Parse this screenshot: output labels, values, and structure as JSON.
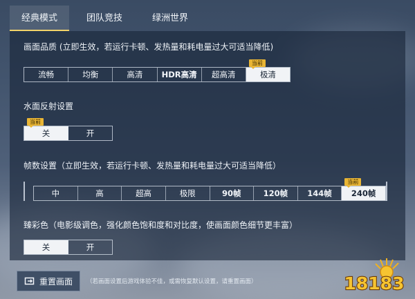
{
  "tabs": [
    {
      "label": "经典模式",
      "active": true
    },
    {
      "label": "团队竞技",
      "active": false
    },
    {
      "label": "绿洲世界",
      "active": false
    }
  ],
  "current_badge": "当前",
  "quality": {
    "title": "画面品质 (立即生效，若运行卡顿、发热量和耗电量过大可适当降低)",
    "options": [
      "流畅",
      "均衡",
      "高清",
      "HDR高清",
      "超高清",
      "极清"
    ],
    "selected": "极清"
  },
  "water_reflection": {
    "title": "水面反射设置",
    "options": [
      "关",
      "开"
    ],
    "selected": "关"
  },
  "frame_rate": {
    "title": "帧数设置（立即生效，若运行卡顿、发热量和耗电量过大可适当降低）",
    "options": [
      "中",
      "高",
      "超高",
      "极限",
      "90帧",
      "120帧",
      "144帧",
      "240帧"
    ],
    "selected": "240帧"
  },
  "vivid_color": {
    "title": "臻彩色（电影级调色，强化颜色饱和度和对比度，使画面颜色细节更丰富）",
    "options": [
      "关",
      "开"
    ],
    "selected": "关"
  },
  "reset": {
    "label": "重置画面",
    "note": "（若画面设置后游戏体验不佳，或需恢复默认设置，请重置画面）"
  },
  "watermark": "18183",
  "colors": {
    "accent": "#f3d36a",
    "badge": "#e9b534",
    "selected_bg": "#f1f3f6",
    "panel": "#182538"
  }
}
